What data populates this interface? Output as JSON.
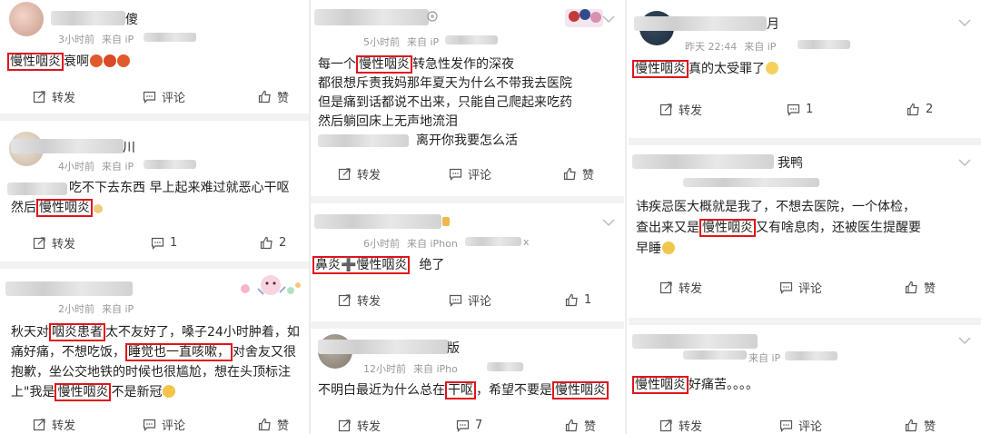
{
  "labels": {
    "repost": "转发",
    "comment": "评论",
    "like": "赞"
  },
  "col0": {
    "post1": {
      "name_frag": "傻",
      "time": "3小时前",
      "source": "来自 iP",
      "body_hl": "慢性咽炎",
      "body_rest": "衰啊",
      "counts": {
        "comment": "",
        "like": ""
      }
    },
    "post2": {
      "name_frag": "川",
      "time": "4小时前",
      "source": "来自 iP",
      "line1": "吃不下去东西 早上起来难过就恶心干呕",
      "line2_pre": "然后",
      "line2_hl": "慢性咽炎",
      "counts": {
        "comment": "1",
        "like": "2"
      }
    },
    "post3": {
      "time": "2小时前",
      "source": "来自 iP",
      "l1_pre": "秋天对",
      "l1_hl": "咽炎患者",
      "l1_post": "太不友好了，嗓子24小时肿着，如",
      "l2_pre": "痛好痛，不想吃饭，",
      "l2_hl": "睡觉也一直咳嗽，",
      "l2_post": "对舍友又很",
      "l3": "抱歉，坐公交地铁的时候也很尴尬，想在头顶标注",
      "l4_pre": "上\"我是",
      "l4_hl": "慢性咽炎",
      "l4_post": "不是新冠",
      "counts": {
        "comment": "",
        "like": ""
      }
    }
  },
  "col1": {
    "post1": {
      "time": "5小时前",
      "source": "来自 iP",
      "l1_pre": "每一个",
      "l1_hl": "慢性咽炎",
      "l1_post": "转急性发作的深夜",
      "l2": "都很想斥责我妈那年夏天为什么不带我去医院",
      "l3": "但是痛到话都说不出来，只能自己爬起来吃药",
      "l4": "然后躺回床上无声地流泪",
      "l5": "离开你我要怎么活",
      "counts": {
        "comment": "",
        "like": ""
      }
    },
    "post2": {
      "time": "6小时前",
      "source": "来自 iPhon",
      "source_tail": "x",
      "body_hl": "鼻炎➕慢性咽炎",
      "body_rest": "绝了",
      "counts": {
        "comment": "1",
        "like": "1"
      }
    },
    "post3": {
      "name_frag": "版",
      "time": "12小时前",
      "source": "来自 iPho",
      "l1_pre": "不明白最近为什么总在",
      "l1_hl": "干呕",
      "l1_mid": "，希望不要是",
      "l1_hl2": "慢性咽炎",
      "counts": {
        "comment": "7",
        "like": ""
      }
    }
  },
  "col2": {
    "post1": {
      "name_frag": "月",
      "time": "昨天 22:44",
      "source": "来自 iP",
      "body_hl": "慢性咽炎",
      "body_rest": "真的太受罪了",
      "counts": {
        "comment": "1",
        "like": "2"
      }
    },
    "post2": {
      "name_frag": "我鸭",
      "l1": "讳疾忌医大概就是我了，不想去医院，一个体检，",
      "l2_pre": "查出来又是",
      "l2_hl": "慢性咽炎",
      "l2_post": "又有啥息肉，还被医生提醒要",
      "l3": "早睡",
      "counts": {
        "comment": "",
        "like": ""
      }
    },
    "post3": {
      "source": "来自 iP",
      "body_hl": "慢性咽炎",
      "body_rest": "好痛苦。。。。",
      "counts": {
        "comment": "",
        "like": ""
      }
    }
  },
  "colors": {
    "highlight": "#e1141b",
    "meta": "#999999",
    "separator": "#f2f2f2"
  }
}
